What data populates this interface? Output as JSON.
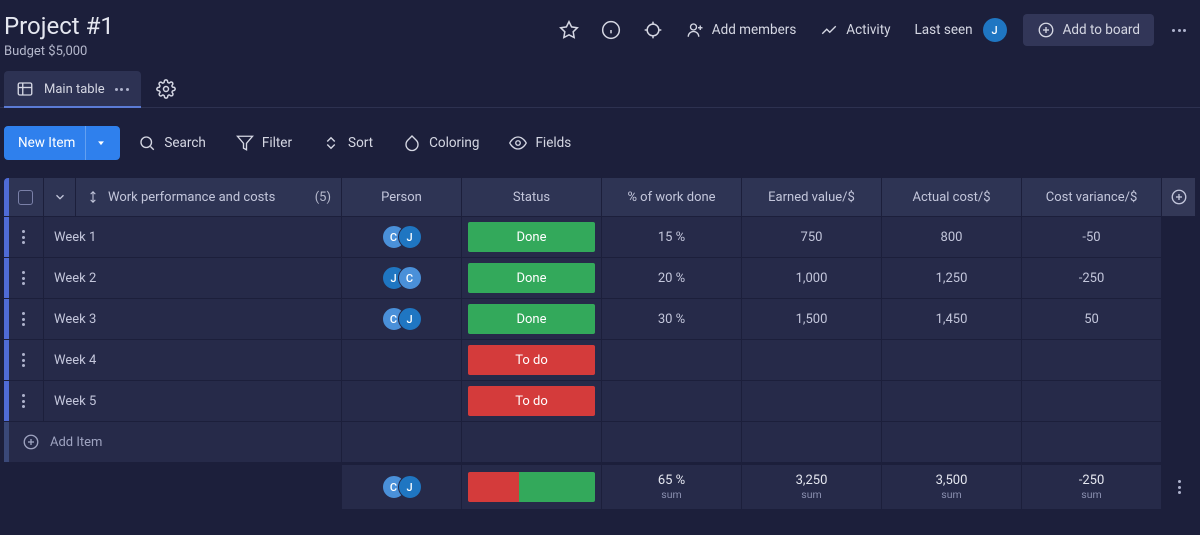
{
  "header": {
    "title": "Project #1",
    "subtitle": "Budget $5,000",
    "actions": {
      "add_members": "Add members",
      "activity": "Activity",
      "last_seen": "Last seen",
      "user_initial": "J",
      "add_to_board": "Add to board"
    }
  },
  "tabs": {
    "main_table": "Main table"
  },
  "toolbar": {
    "new_item": "New Item",
    "search": "Search",
    "filter": "Filter",
    "sort": "Sort",
    "coloring": "Coloring",
    "fields": "Fields"
  },
  "table": {
    "headers": {
      "group": "Work performance and costs",
      "count": "(5)",
      "person": "Person",
      "status": "Status",
      "pct": "% of work done",
      "earned": "Earned value/$",
      "actual": "Actual cost/$",
      "variance": "Cost variance/$"
    },
    "rows": [
      {
        "name": "Week 1",
        "persons": [
          "C",
          "J"
        ],
        "status_label": "Done",
        "status_class": "status-done",
        "pct": "15 %",
        "earned": "750",
        "actual": "800",
        "variance": "-50"
      },
      {
        "name": "Week 2",
        "persons": [
          "J",
          "C"
        ],
        "status_label": "Done",
        "status_class": "status-done",
        "pct": "20 %",
        "earned": "1,000",
        "actual": "1,250",
        "variance": "-250"
      },
      {
        "name": "Week 3",
        "persons": [
          "C",
          "J"
        ],
        "status_label": "Done",
        "status_class": "status-done",
        "pct": "30 %",
        "earned": "1,500",
        "actual": "1,450",
        "variance": "50"
      },
      {
        "name": "Week 4",
        "persons": [],
        "status_label": "To do",
        "status_class": "status-todo",
        "pct": "",
        "earned": "",
        "actual": "",
        "variance": ""
      },
      {
        "name": "Week 5",
        "persons": [],
        "status_label": "To do",
        "status_class": "status-todo",
        "pct": "",
        "earned": "",
        "actual": "",
        "variance": ""
      }
    ],
    "add_item": "Add Item",
    "summary": {
      "persons": [
        "C",
        "J"
      ],
      "battery_red_pct": 40,
      "battery_green_pct": 60,
      "pct": {
        "val": "65 %",
        "lab": "sum"
      },
      "earned": {
        "val": "3,250",
        "lab": "sum"
      },
      "actual": {
        "val": "3,500",
        "lab": "sum"
      },
      "variance": {
        "val": "-250",
        "lab": "sum"
      }
    }
  },
  "colors": {
    "done": "#33a95b",
    "todo": "#d43b3b",
    "accent": "#2f80ed"
  }
}
